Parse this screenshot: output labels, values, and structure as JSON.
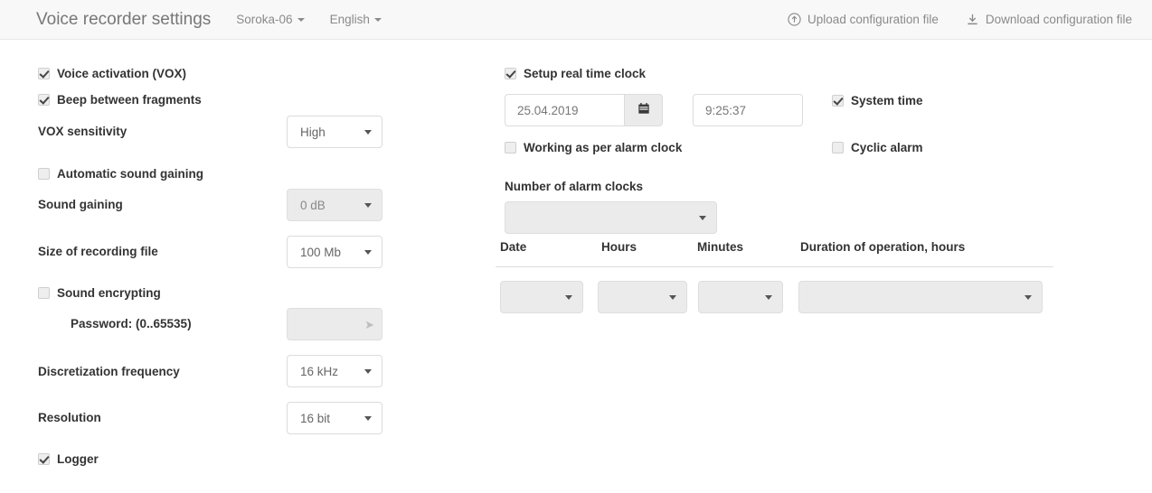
{
  "header": {
    "title": "Voice recorder settings",
    "device": "Soroka-06",
    "language": "English",
    "upload_label": "Upload configuration file",
    "download_label": "Download configuration file"
  },
  "left": {
    "voice_activation": {
      "label": "Voice activation (VOX)",
      "checked": true
    },
    "beep_between_fragments": {
      "label": "Beep between fragments",
      "checked": true
    },
    "vox_sensitivity": {
      "label": "VOX sensitivity",
      "value": "High"
    },
    "automatic_sound_gaining": {
      "label": "Automatic sound gaining",
      "checked": false
    },
    "sound_gaining": {
      "label": "Sound gaining",
      "value": "0 dB"
    },
    "size_of_recording_file": {
      "label": "Size of recording file",
      "value": "100 Mb"
    },
    "sound_encrypting": {
      "label": "Sound encrypting",
      "checked": false
    },
    "password": {
      "label": "Password: (0..65535)",
      "value": ""
    },
    "discretization_frequency": {
      "label": "Discretization frequency",
      "value": "16 kHz"
    },
    "resolution": {
      "label": "Resolution",
      "value": "16 bit"
    },
    "logger": {
      "label": "Logger",
      "checked": true
    }
  },
  "right": {
    "setup_real_time_clock": {
      "label": "Setup real time clock",
      "checked": true
    },
    "date": {
      "value": "25.04.2019"
    },
    "time": {
      "value": "9:25:37"
    },
    "system_time": {
      "label": "System time",
      "checked": true
    },
    "working_as_per_alarm_clock": {
      "label": "Working as per alarm clock",
      "checked": false
    },
    "cyclic_alarm": {
      "label": "Cyclic alarm",
      "checked": false
    },
    "number_of_alarm_clocks": {
      "label": "Number of alarm clocks",
      "value": ""
    },
    "alarm_table": {
      "columns": [
        "Date",
        "Hours",
        "Minutes",
        "Duration of operation, hours"
      ],
      "rows": [
        {
          "date": "",
          "hours": "",
          "minutes": "",
          "duration": ""
        }
      ]
    }
  }
}
